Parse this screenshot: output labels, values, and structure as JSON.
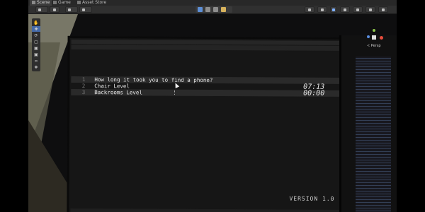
{
  "window": {
    "tabs": [
      {
        "label": "Scene"
      },
      {
        "label": "Game"
      },
      {
        "label": "Asset Store"
      }
    ]
  },
  "scene": {
    "gizmo_label": "< Persp"
  },
  "terminal": {
    "lines": [
      {
        "num": "1",
        "text": "How long it took you to find a phone?",
        "time": ""
      },
      {
        "num": "2",
        "text": "Chair Level",
        "time": "07:13"
      },
      {
        "num": "3",
        "text": "Backrooms Level",
        "time": "00:00"
      }
    ],
    "version": "VERSION 1.0"
  },
  "colors": {
    "accent": "#456aa8",
    "axis_x": "#e74c3c",
    "axis_y": "#8bc34a",
    "axis_z": "#5a8de0"
  }
}
